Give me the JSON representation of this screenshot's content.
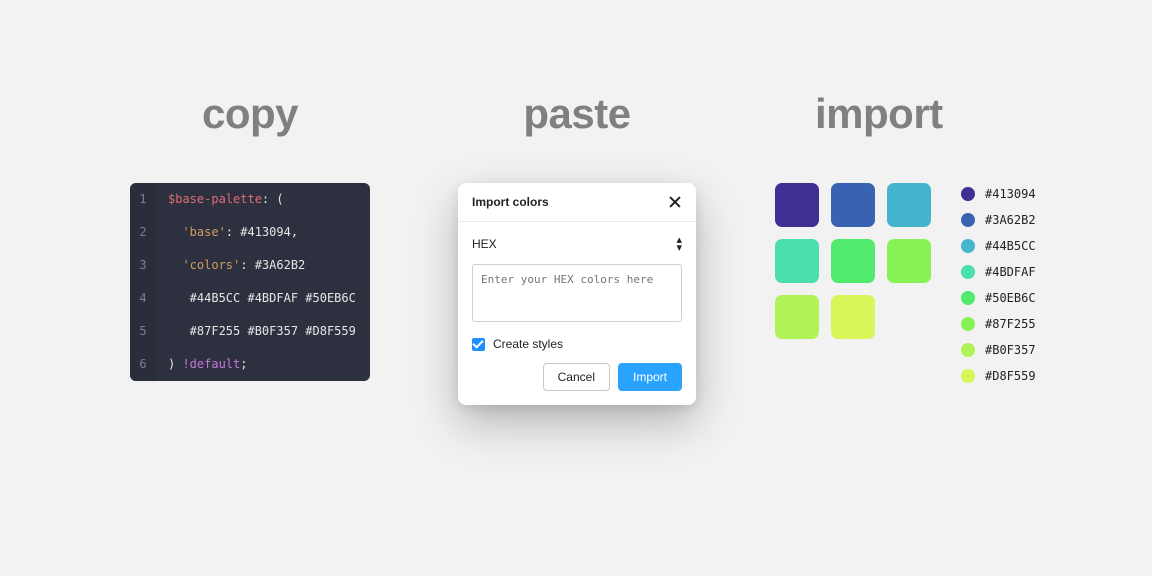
{
  "headings": {
    "copy": "copy",
    "paste": "paste",
    "import": "import"
  },
  "code": {
    "line_numbers": [
      "1",
      "2",
      "3",
      "4",
      "5",
      "6"
    ],
    "l1_a": "$base-palette",
    "l1_b": ": (",
    "l2_a": "  'base'",
    "l2_b": ": #413094,",
    "l3_a": "  'colors'",
    "l3_b": ": #3A62B2",
    "l4": "   #44B5CC #4BDFAF #50EB6C",
    "l5": "   #87F255 #B0F357 #D8F559",
    "l6_a": ") ",
    "l6_b": "!default",
    "l6_c": ";"
  },
  "dialog": {
    "title": "Import colors",
    "format_label": "HEX",
    "placeholder": "Enter your HEX colors here",
    "checkbox_label": "Create styles",
    "checkbox_checked": true,
    "cancel": "Cancel",
    "import": "Import"
  },
  "palette": {
    "colors": [
      "#413094",
      "#3A62B2",
      "#44B5CC",
      "#4BDFAF",
      "#50EB6C",
      "#87F255",
      "#B0F357",
      "#D8F559"
    ],
    "labels": [
      "#413094",
      "#3A62B2",
      "#44B5CC",
      "#4BDFAF",
      "#50EB6C",
      "#87F255",
      "#B0F357",
      "#D8F559"
    ]
  }
}
